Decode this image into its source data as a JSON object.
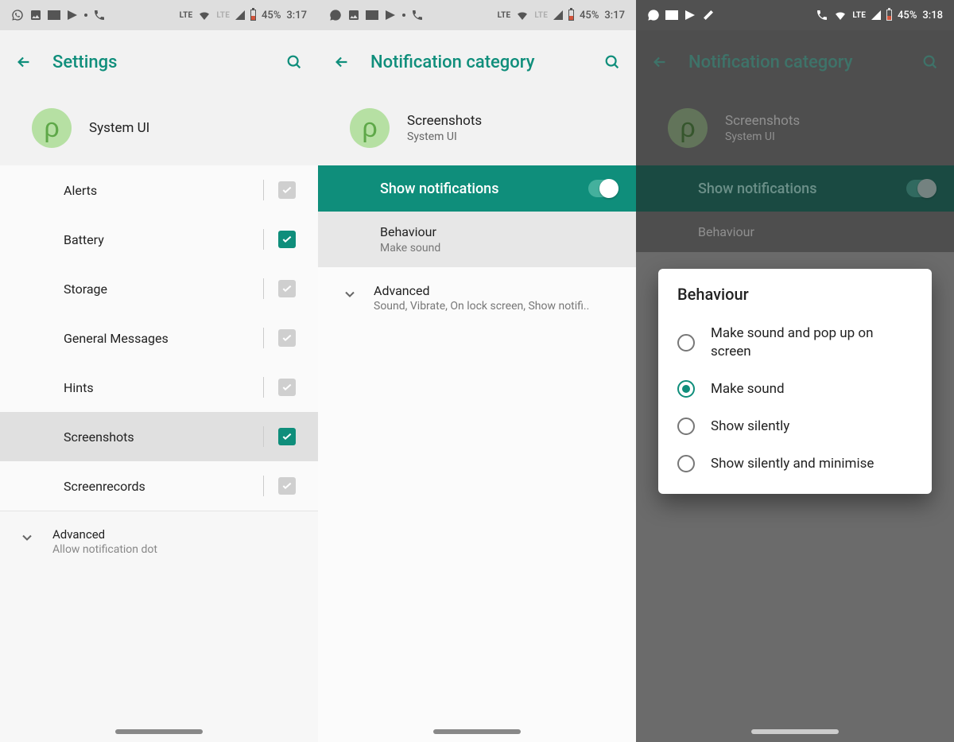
{
  "status": {
    "battery": "45%",
    "time_a": "3:17",
    "time_b": "3:18"
  },
  "panel1": {
    "title": "Settings",
    "app": "System UI",
    "items": [
      {
        "label": "Alerts",
        "checked": false
      },
      {
        "label": "Battery",
        "checked": true
      },
      {
        "label": "Storage",
        "checked": false
      },
      {
        "label": "General Messages",
        "checked": false
      },
      {
        "label": "Hints",
        "checked": false
      },
      {
        "label": "Screenshots",
        "checked": true,
        "selected": true
      },
      {
        "label": "Screenrecords",
        "checked": false
      }
    ],
    "advanced": {
      "title": "Advanced",
      "subtitle": "Allow notification dot"
    }
  },
  "panel2": {
    "title": "Notification category",
    "header": {
      "title": "Screenshots",
      "subtitle": "System UI"
    },
    "banner": "Show notifications",
    "behaviour": {
      "title": "Behaviour",
      "subtitle": "Make sound"
    },
    "advanced": {
      "title": "Advanced",
      "subtitle": "Sound, Vibrate, On lock screen, Show notifi.."
    }
  },
  "panel3": {
    "title": "Notification category",
    "header": {
      "title": "Screenshots",
      "subtitle": "System UI"
    },
    "banner": "Show notifications",
    "behaviour_row": "Behaviour",
    "dialog": {
      "title": "Behaviour",
      "options": [
        {
          "label": "Make sound and pop up on screen",
          "selected": false
        },
        {
          "label": "Make sound",
          "selected": true
        },
        {
          "label": "Show silently",
          "selected": false
        },
        {
          "label": "Show silently and minimise",
          "selected": false
        }
      ]
    }
  }
}
